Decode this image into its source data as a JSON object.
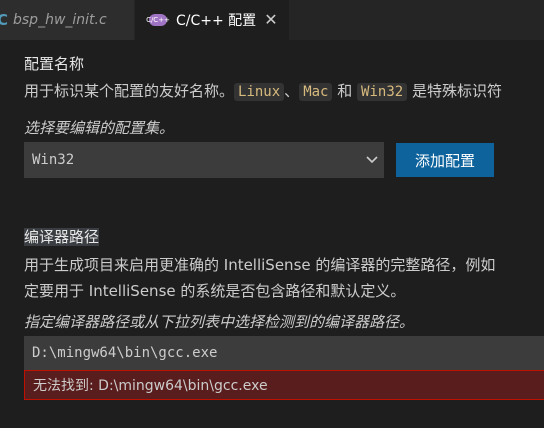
{
  "tabs": {
    "inactive": {
      "icon": "c-file-icon",
      "icon_glyph": "C",
      "label": "bsp_hw_init.c"
    },
    "active": {
      "icon": "cpp-settings-icon",
      "icon_text": "C/C++",
      "label": "C/C++ 配置",
      "close_glyph": "✕"
    }
  },
  "config_name": {
    "title": "配置名称",
    "desc_prefix": "用于标识某个配置的友好名称。",
    "code_linux": "Linux",
    "sep1": "、",
    "code_mac": "Mac",
    "and": " 和 ",
    "code_win32": "Win32",
    "desc_suffix": " 是特殊标识符"
  },
  "config_select": {
    "hint": "选择要编辑的配置集。",
    "value": "Win32",
    "add_button": "添加配置"
  },
  "compiler_path": {
    "title": "编译器路径",
    "desc_line1": "用于生成项目来启用更准确的 IntelliSense 的编译器的完整路径，例如",
    "desc_line2": "定要用于 IntelliSense 的系统是否包含路径和默认定义。",
    "hint": "指定编译器路径或从下拉列表中选择检测到的编译器路径。",
    "value": "D:\\mingw64\\bin\\gcc.exe",
    "error": "无法找到: D:\\mingw64\\bin\\gcc.exe"
  },
  "colors": {
    "background": "#1e1e1e",
    "button": "#0e639c",
    "error_bg": "#5a1d1d",
    "error_border": "#be1100",
    "code_fg": "#d7ba7d"
  }
}
